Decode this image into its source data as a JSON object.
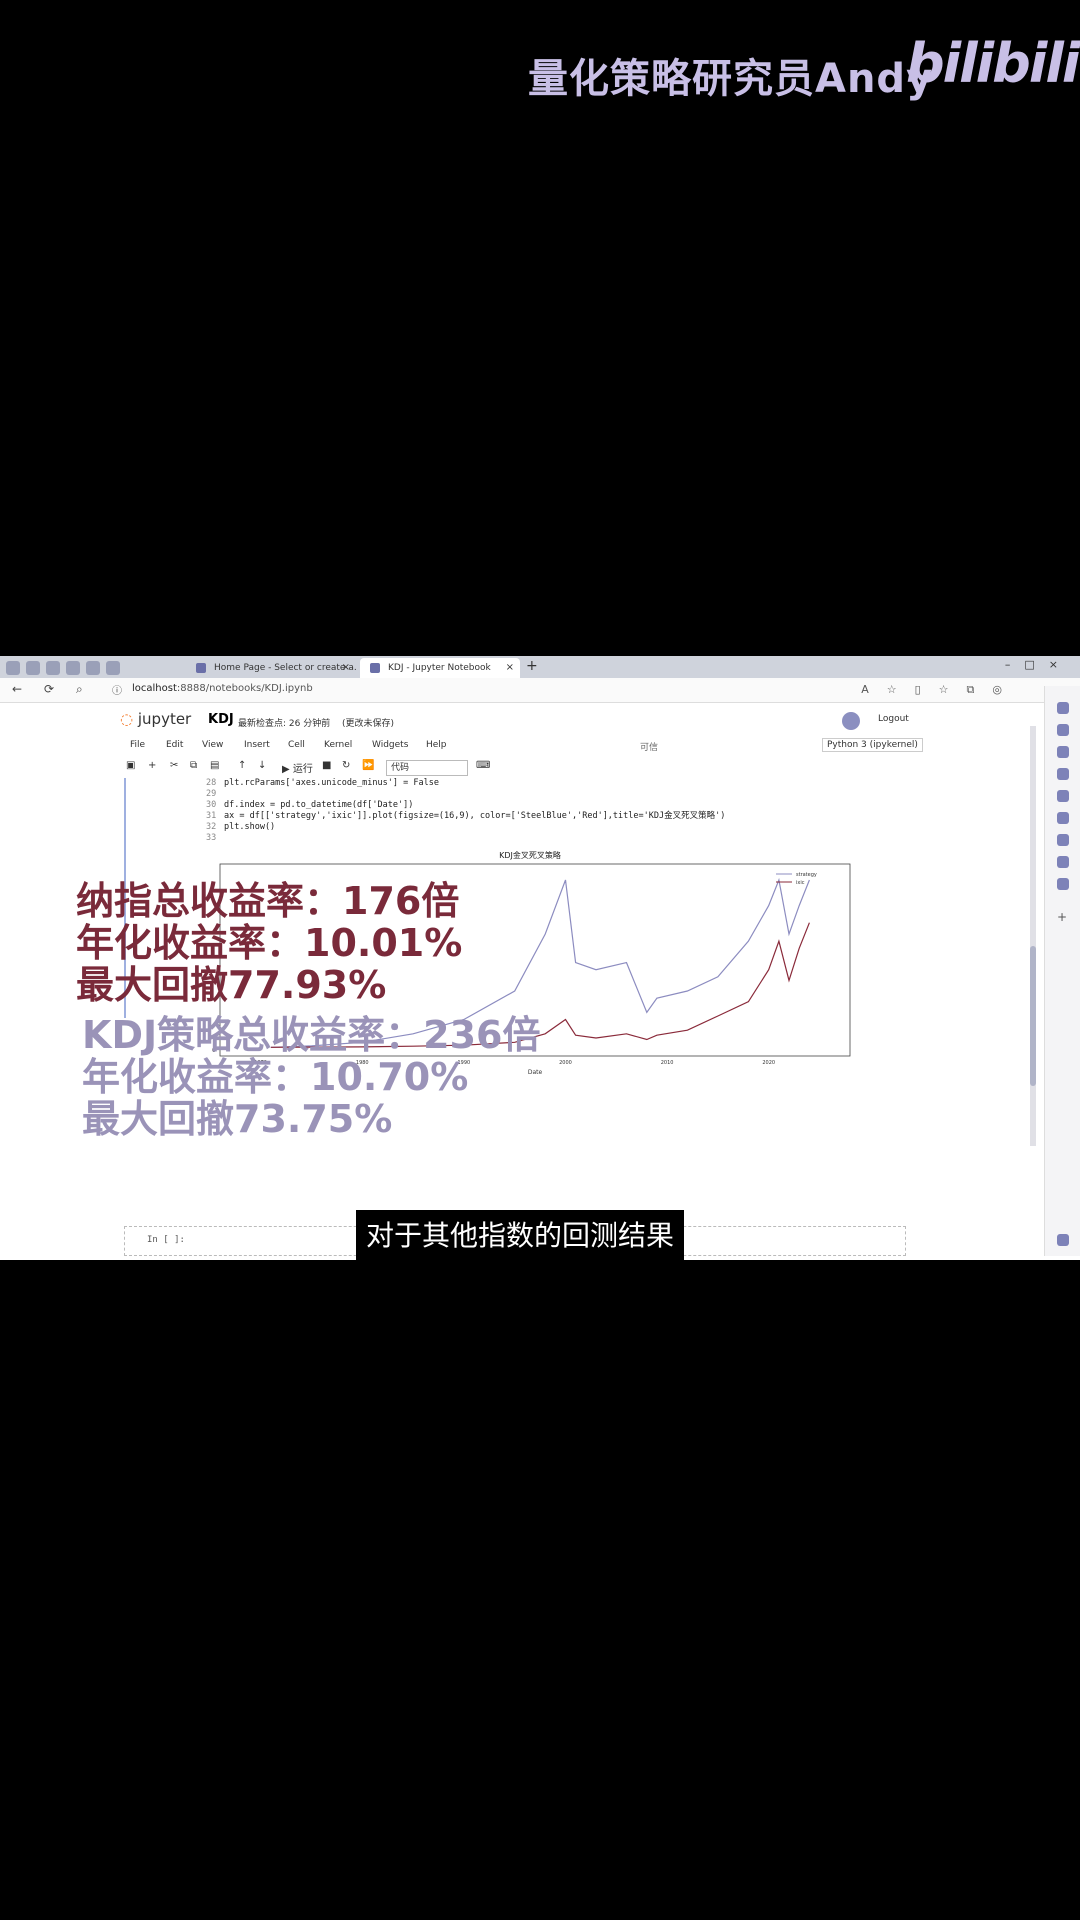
{
  "watermark": {
    "author": "量化策略研究员Andy",
    "logo": "bilibili"
  },
  "browser": {
    "tabs": [
      {
        "label": "Home Page - Select or create a..."
      },
      {
        "label": "KDJ - Jupyter Notebook"
      }
    ],
    "url_host": "localhost",
    "url_rest": ":8888/notebooks/KDJ.ipynb"
  },
  "jupyter": {
    "logo": "jupyter",
    "notebook_name": "KDJ",
    "checkpoint": "最新检查点: 26 分钟前",
    "unsaved": "(更改未保存)",
    "logout": "Logout",
    "menus": [
      "File",
      "Edit",
      "View",
      "Insert",
      "Cell",
      "Kernel",
      "Widgets",
      "Help"
    ],
    "trusted": "可信",
    "kernel": "Python 3 (ipykernel)",
    "run_label": "运行",
    "cell_type": "代码",
    "code_lines": [
      {
        "n": "28",
        "code": "plt.rcParams['axes.unicode_minus'] = False"
      },
      {
        "n": "29",
        "code": ""
      },
      {
        "n": "30",
        "code": "df.index = pd.to_datetime(df['Date'])"
      },
      {
        "n": "31",
        "code": "ax = df[['strategy','ixic']].plot(figsize=(16,9), color=['SteelBlue','Red'],title='KDJ金叉死叉策略')"
      },
      {
        "n": "32",
        "code": "plt.show()"
      },
      {
        "n": "33",
        "code": ""
      }
    ],
    "input_prompt": "In [ ]:"
  },
  "chart_data": {
    "type": "line",
    "title": "KDJ金叉死叉策略",
    "xlabel": "Date",
    "x_ticks": [
      "1970",
      "1980",
      "1990",
      "2000",
      "2010",
      "2020"
    ],
    "y_ticks": [
      "0"
    ],
    "legend": {
      "position": "top-right",
      "entries": [
        "strategy",
        "ixic"
      ]
    },
    "series": [
      {
        "name": "strategy",
        "color": "#8c8cc0",
        "x": [
          1971,
          1975,
          1980,
          1985,
          1990,
          1995,
          1998,
          2000,
          2001,
          2003,
          2006,
          2008,
          2009,
          2012,
          2015,
          2018,
          2020,
          2021,
          2022,
          2023,
          2024
        ],
        "y": [
          1,
          3,
          8,
          20,
          40,
          80,
          160,
          236,
          120,
          110,
          120,
          50,
          70,
          80,
          100,
          150,
          200,
          236,
          160,
          200,
          236
        ]
      },
      {
        "name": "ixic",
        "color": "#8a2a3a",
        "x": [
          1971,
          1975,
          1980,
          1985,
          1990,
          1995,
          1998,
          2000,
          2001,
          2003,
          2006,
          2008,
          2009,
          2012,
          2015,
          2018,
          2020,
          2021,
          2022,
          2023,
          2024
        ],
        "y": [
          1,
          1.2,
          1.5,
          2.5,
          4,
          8,
          20,
          40,
          18,
          14,
          20,
          12,
          18,
          25,
          45,
          65,
          110,
          150,
          95,
          140,
          176
        ]
      }
    ],
    "ylim": [
      0,
      250
    ]
  },
  "overlay": {
    "nasdaq_lines": [
      "纳指总收益率：176倍",
      "年化收益率：10.01%",
      "最大回撤77.93%"
    ],
    "kdj_lines": [
      "KDJ策略总收益率：236倍",
      "年化收益率：10.70%",
      "最大回撤73.75%"
    ]
  },
  "subtitle": "对于其他指数的回测结果"
}
